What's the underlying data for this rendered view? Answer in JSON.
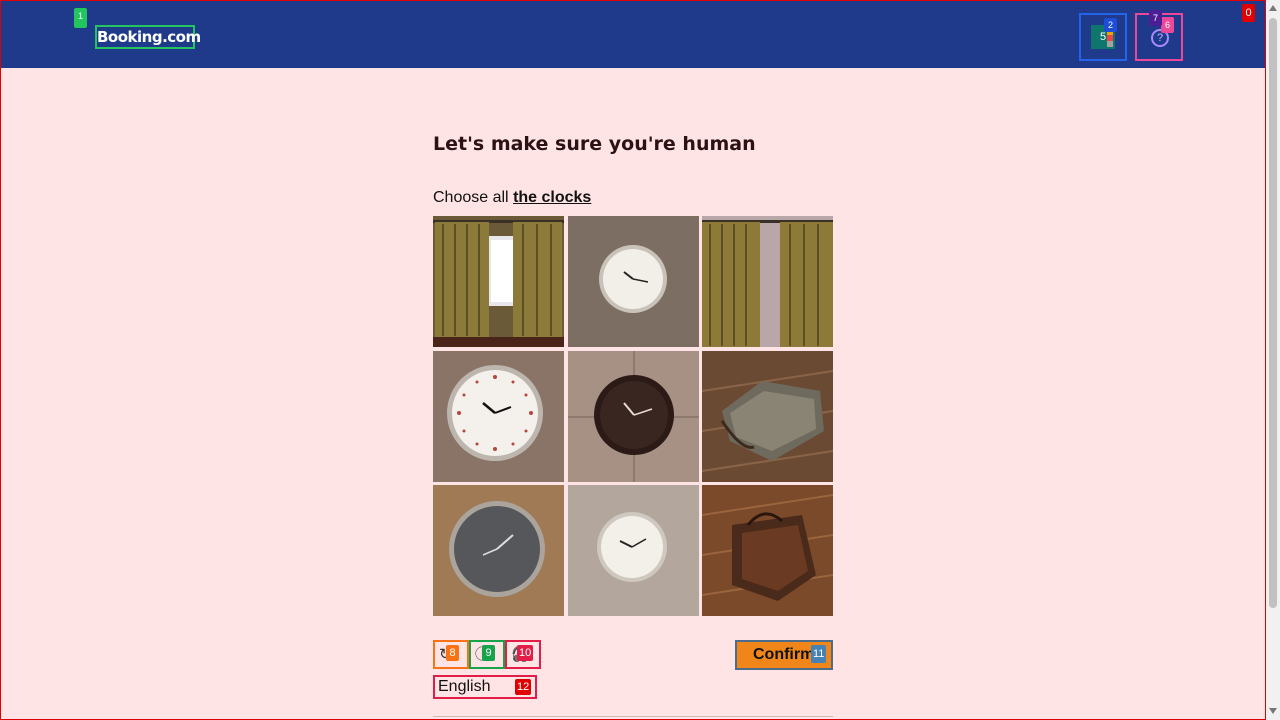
{
  "header": {
    "logo": "Booking.com",
    "currency_icon_text": "5",
    "help_icon_text": "?"
  },
  "captcha": {
    "title": "Let's make sure you're human",
    "instruction_prefix": "Choose all",
    "instruction_target": "the clocks",
    "tiles": [
      {
        "subject": "curtains-window"
      },
      {
        "subject": "clock-white"
      },
      {
        "subject": "curtains"
      },
      {
        "subject": "clock-red-numbers"
      },
      {
        "subject": "clock-dark"
      },
      {
        "subject": "bag-grey"
      },
      {
        "subject": "clock-grey"
      },
      {
        "subject": "clock-white"
      },
      {
        "subject": "bag-brown"
      }
    ],
    "tool_buttons": [
      "refresh-icon",
      "info-icon",
      "audio-icon"
    ],
    "confirm_label": "Confirm",
    "language": "English"
  },
  "markers": [
    "0",
    "1",
    "2",
    "5",
    "6",
    "7",
    "8",
    "9",
    "10",
    "11",
    "12"
  ],
  "colors": {
    "header_bg": "#1f3a8a",
    "page_bg": "#ffe4e6",
    "confirm_bg": "#f0861a"
  }
}
